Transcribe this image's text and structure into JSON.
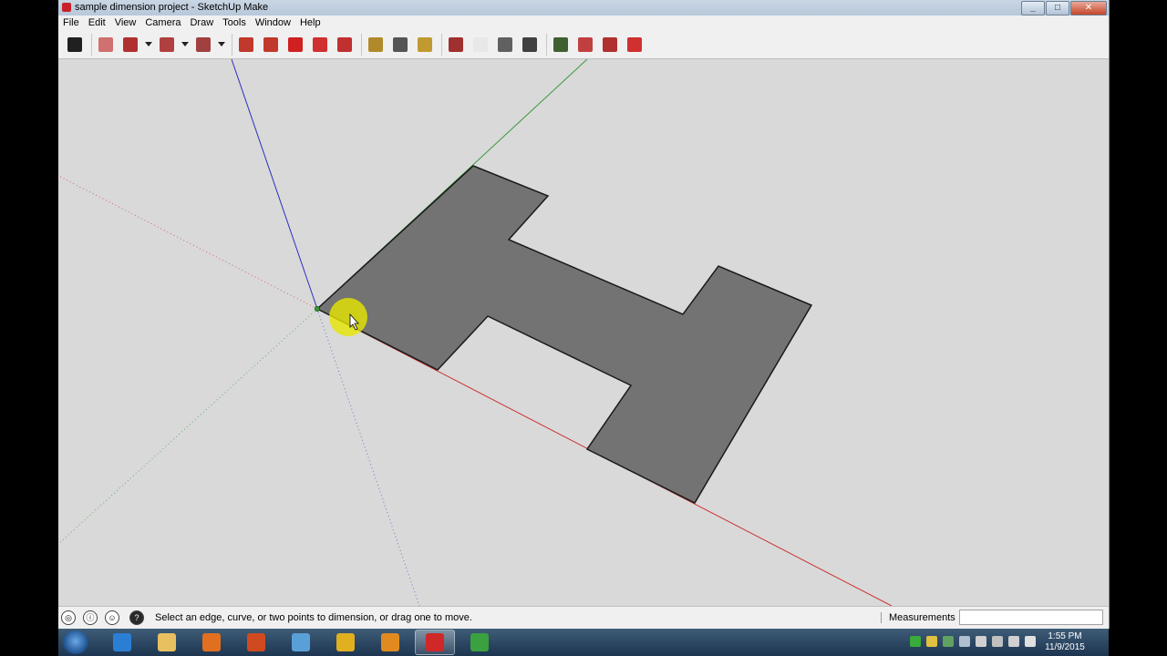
{
  "window": {
    "title": "sample dimension project - SketchUp Make",
    "controls": [
      "minimize-icon",
      "maximize-icon",
      "close-icon"
    ]
  },
  "menu": [
    "File",
    "Edit",
    "View",
    "Camera",
    "Draw",
    "Tools",
    "Window",
    "Help"
  ],
  "toolbar": {
    "tools": [
      {
        "name": "select-tool",
        "color": "#202020"
      },
      {
        "name": "eraser-tool",
        "color": "#d07070"
      },
      {
        "name": "line-tool",
        "color": "#b03030",
        "dropdown": true
      },
      {
        "name": "arc-tool",
        "color": "#b04040",
        "dropdown": true
      },
      {
        "name": "rectangle-tool",
        "color": "#a04040",
        "dropdown": true
      },
      {
        "name": "push-pull-tool",
        "color": "#c0392b"
      },
      {
        "name": "follow-me-tool",
        "color": "#c0392b"
      },
      {
        "name": "move-tool",
        "color": "#d02020"
      },
      {
        "name": "rotate-tool",
        "color": "#d03030"
      },
      {
        "name": "scale-tool",
        "color": "#c03030"
      },
      {
        "name": "tape-measure-tool",
        "color": "#b08a2a"
      },
      {
        "name": "text-tool",
        "color": "#555555"
      },
      {
        "name": "paint-bucket-tool",
        "color": "#c09a30"
      },
      {
        "name": "orbit-tool",
        "color": "#a03030"
      },
      {
        "name": "pan-tool",
        "color": "#e8e8e8"
      },
      {
        "name": "zoom-tool",
        "color": "#606060"
      },
      {
        "name": "zoom-extents-tool",
        "color": "#404040"
      },
      {
        "name": "3d-warehouse-tool",
        "color": "#406030"
      },
      {
        "name": "share-model-tool",
        "color": "#c04040"
      },
      {
        "name": "components-tool",
        "color": "#b03030"
      },
      {
        "name": "extension-warehouse-tool",
        "color": "#d03030"
      }
    ]
  },
  "status": {
    "message": "Select an edge, curve, or two points to dimension, or drag one to move.",
    "measurements_label": "Measurements",
    "measurements_value": ""
  },
  "taskbar": {
    "apps": [
      {
        "name": "internet-explorer",
        "color": "#2a7fd4"
      },
      {
        "name": "file-explorer",
        "color": "#e8c060"
      },
      {
        "name": "media-player",
        "color": "#e07020"
      },
      {
        "name": "powerpoint",
        "color": "#d04a20"
      },
      {
        "name": "remote-viewer",
        "color": "#5aa0d8"
      },
      {
        "name": "chrome",
        "color": "#e0b020"
      },
      {
        "name": "outlook",
        "color": "#e08a20"
      },
      {
        "name": "sketchup",
        "color": "#d02828",
        "active": true
      },
      {
        "name": "camtasia",
        "color": "#3aa040"
      }
    ],
    "tray_colors": [
      "#3aaa3a",
      "#e0c040",
      "#60a060",
      "#b0c0d0",
      "#d0d0d0",
      "#c0c0c0",
      "#d0d0d0",
      "#e0e0e0"
    ],
    "time": "1:55 PM",
    "date": "11/9/2015"
  },
  "colors": {
    "face": "#737373",
    "red_axis": "#cc3333",
    "green_axis": "#3a9a3a",
    "blue_axis": "#2e2ec0",
    "highlight": "#e6e600"
  }
}
